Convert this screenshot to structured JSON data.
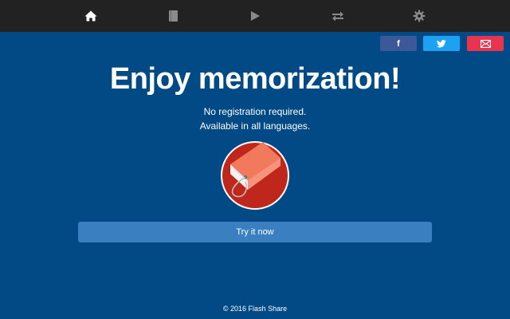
{
  "nav": {
    "items": [
      {
        "icon": "home-icon",
        "active": true
      },
      {
        "icon": "book-icon",
        "active": false
      },
      {
        "icon": "play-icon",
        "active": false
      },
      {
        "icon": "transfer-icon",
        "active": false
      },
      {
        "icon": "gear-icon",
        "active": false
      }
    ]
  },
  "share": {
    "facebook_label": "f",
    "facebook_color": "#3b5998",
    "twitter_color": "#1da1f2",
    "email_color": "#e8344e"
  },
  "hero": {
    "title": "Enjoy memorization!",
    "line1": "No registration required.",
    "line2": "Available in all languages."
  },
  "cta": {
    "label": "Try it now"
  },
  "footer": {
    "text": "© 2016 Flash Share"
  },
  "colors": {
    "background": "#014a86",
    "navbar": "#222222",
    "button": "#3a7fc0",
    "logo_circle": "#c0271c"
  }
}
